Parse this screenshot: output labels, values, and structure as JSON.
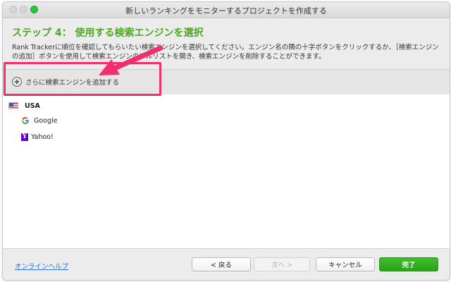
{
  "window": {
    "title": "新しいランキングをモニターするプロジェクトを作成する"
  },
  "step": {
    "title": "ステップ 4： 使用する検索エンジンを選択",
    "description": "Rank Trackerに順位を確認してもらいたい検索エンジンを選択してください。エンジン名の隣の十字ボタンをクリックするか、［検索エンジンの追加］ボタンを使用して検索エンジンのフルリストを開き、検索エンジンを削除することができます。"
  },
  "toolbar": {
    "add_engine_label": "さらに検索エンジンを追加する",
    "add_icon": "plus-circle-icon"
  },
  "engine_list": {
    "country": {
      "label": "USA",
      "icon": "usa-flag-icon"
    },
    "engines": [
      {
        "label": "Google",
        "icon": "google-icon"
      },
      {
        "label": "Yahoo!",
        "icon": "yahoo-icon"
      }
    ]
  },
  "footer": {
    "help_link": "オンラインヘルプ",
    "back_label": "< 戻る",
    "next_label": "次へ >",
    "cancel_label": "キャンセル",
    "finish_label": "完了"
  },
  "colors": {
    "accent_green": "#4caa1c",
    "annotation_pink": "#f0306e",
    "link_blue": "#2a6fd6"
  }
}
